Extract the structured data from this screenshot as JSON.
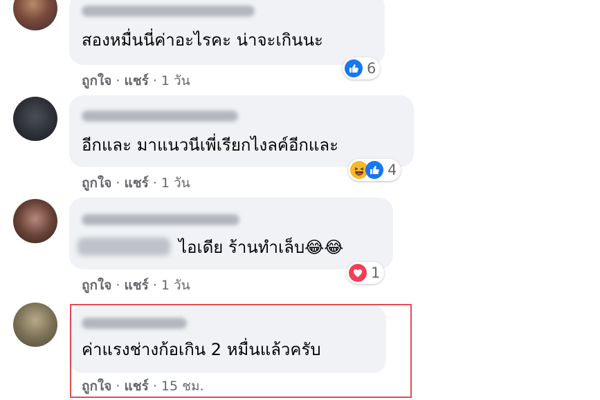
{
  "comments": [
    {
      "text": "สองหมื่นนี่ค่าอะไรคะ น่าจะเกินนะ",
      "reaction_count": "6",
      "like_label": "ถูกใจ",
      "share_label": "แชร์",
      "time": "1 วัน"
    },
    {
      "text": "อีกและ มาแนวนีเพี่เรียกไงลค์อีกและ",
      "reaction_count": "4",
      "like_label": "ถูกใจ",
      "share_label": "แชร์",
      "time": "1 วัน"
    },
    {
      "text": "ไอเดีย ร้านทำเล็บ😂😂",
      "reaction_count": "1",
      "like_label": "ถูกใจ",
      "share_label": "แชร์",
      "time": "1 วัน"
    },
    {
      "text": "ค่าแรงช่างก้อเกิน 2 หมื่นแล้วครับ",
      "like_label": "ถูกใจ",
      "share_label": "แชร์",
      "time": "15 ชม."
    }
  ],
  "separator": "·",
  "colors": {
    "bubble": "#f0f2f5",
    "meta_text": "#65676b",
    "like_blue": "#1877f2",
    "love_red": "#f33e58",
    "highlight_border": "#e34b4f"
  },
  "icons": [
    "like-icon",
    "haha-icon",
    "love-icon"
  ]
}
